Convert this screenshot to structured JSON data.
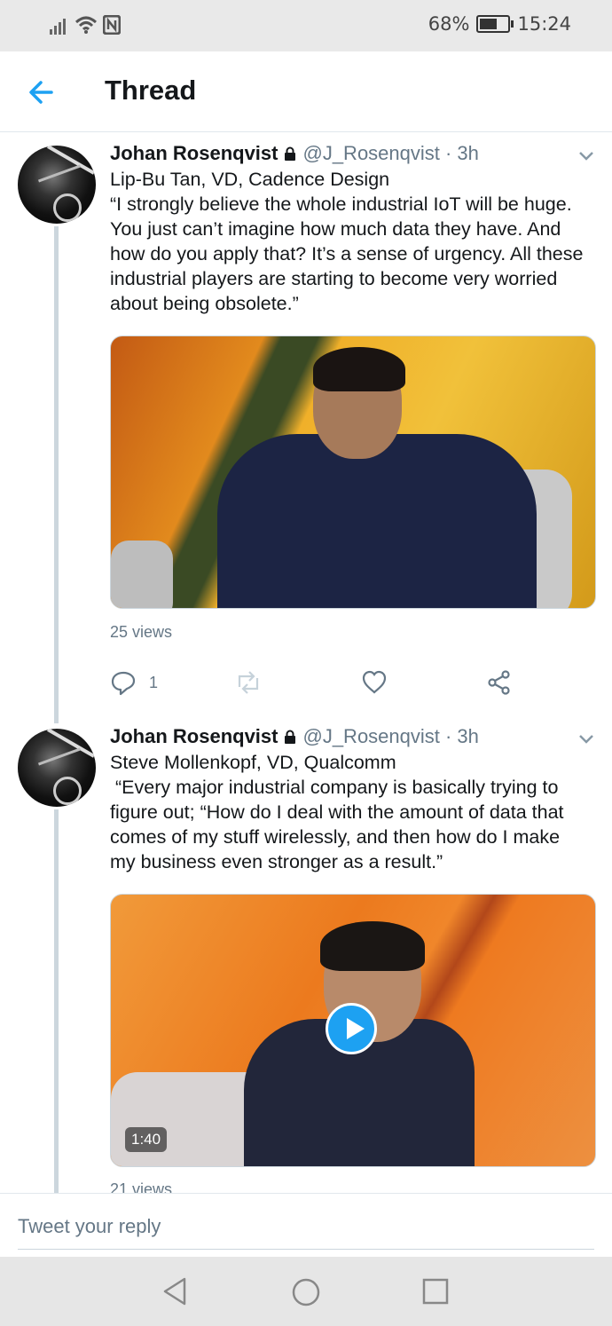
{
  "status_bar": {
    "battery": "68%",
    "time": "15:24",
    "battery_level": 0.68,
    "icons": [
      "signal-icon",
      "wifi-icon",
      "nfc-icon",
      "battery-icon"
    ]
  },
  "header": {
    "title": "Thread",
    "back_icon": "arrow-left-icon"
  },
  "tweets": [
    {
      "name": "Johan Rosenqvist",
      "handle": "@J_Rosenqvist · 3h",
      "text": "Lip-Bu Tan, VD, Cadence Design\n“I strongly believe the whole industrial IoT will be huge. You just can’t imagine how much data they have. And how do you apply that? It’s a sense of urgency. All these industrial players are starting to become very worried about being obsolete.”",
      "views": "25 views",
      "reply_count": "1"
    },
    {
      "name": "Johan Rosenqvist",
      "handle": "@J_Rosenqvist · 3h",
      "text": "Steve Mollenkopf, VD, Qualcomm\n “Every major industrial company is basically trying to figure out; “How do I deal with the amount of data that comes of my stuff wirelessly, and then how do I make my business even stronger as a result.”",
      "video_duration": "1:40",
      "views": "21 views"
    }
  ],
  "reply": {
    "placeholder": "Tweet your reply"
  },
  "colors": {
    "accent": "#1da1f2",
    "text_secondary": "#657786",
    "thread_line": "#ccd6dd"
  }
}
